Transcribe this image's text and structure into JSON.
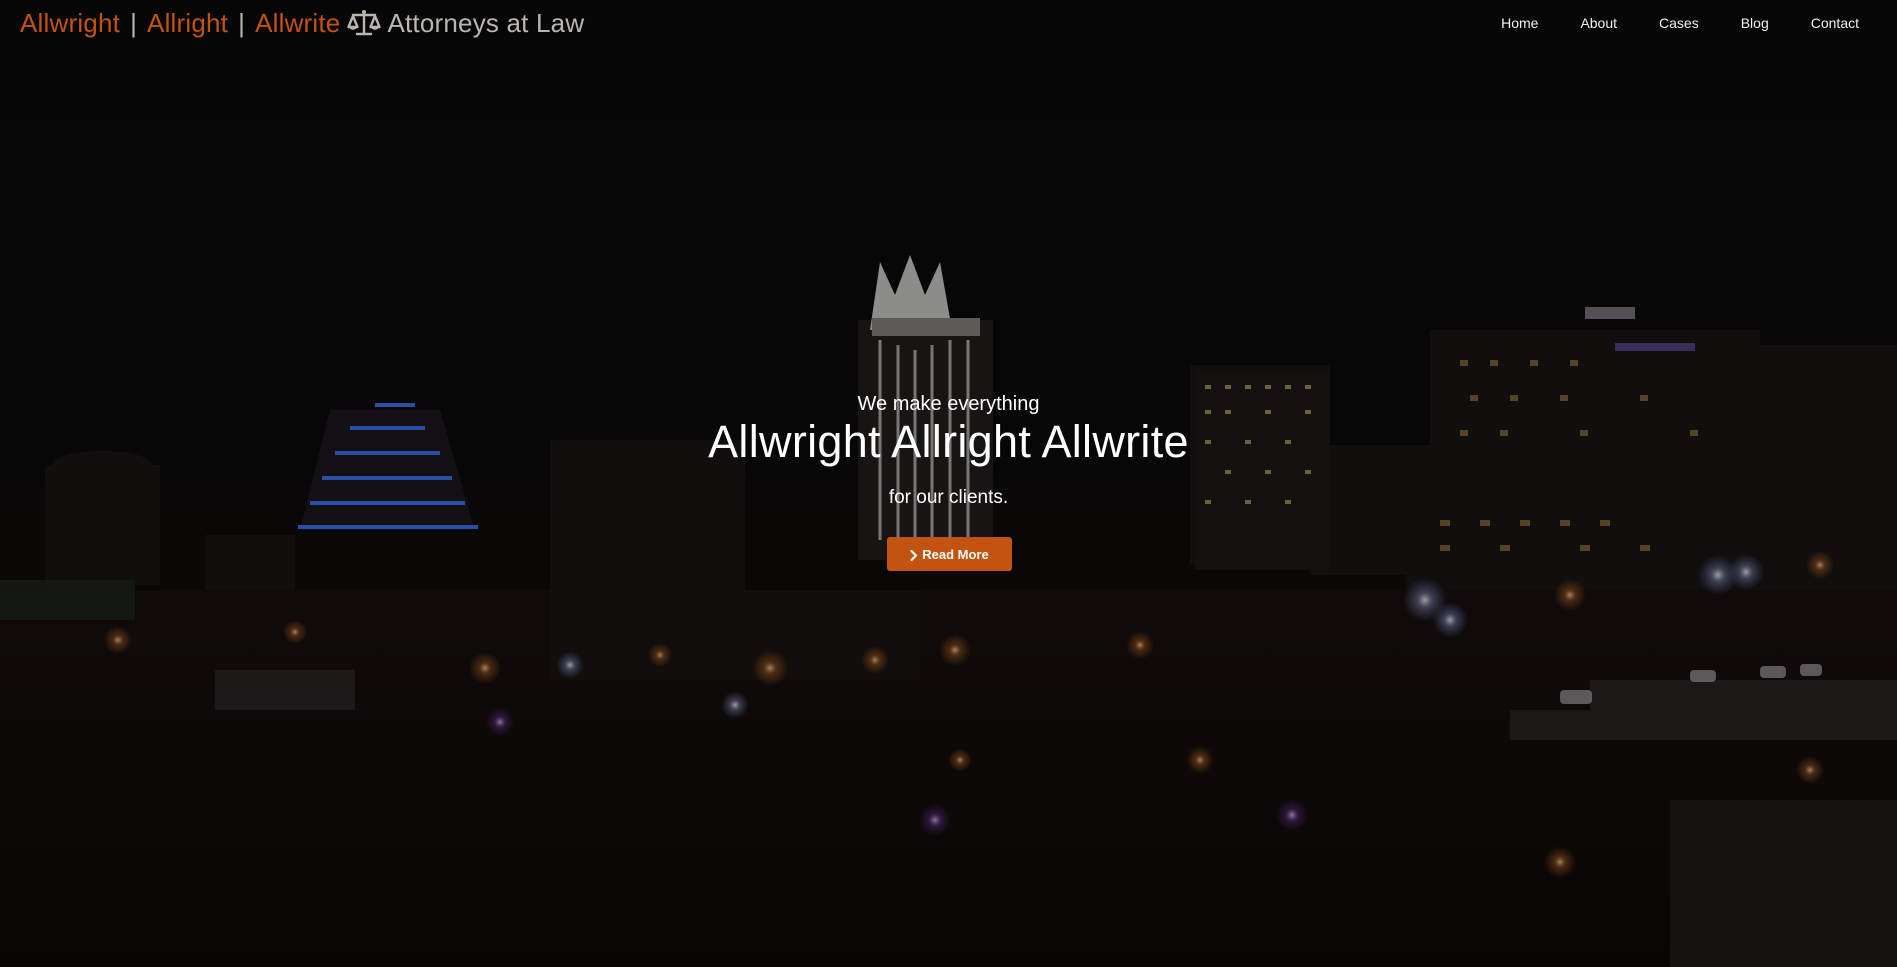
{
  "header": {
    "brand": {
      "name_1": "Allwright",
      "separator_1": "|",
      "name_2": "Allright",
      "separator_2": "|",
      "name_3": "Allwrite",
      "icon": "balance-scale-icon",
      "tagline": "Attorneys at Law"
    },
    "nav": [
      {
        "label": "Home"
      },
      {
        "label": "About"
      },
      {
        "label": "Cases"
      },
      {
        "label": "Blog"
      },
      {
        "label": "Contact"
      }
    ]
  },
  "hero": {
    "kicker": "We make everything",
    "title": "Allwright Allright Allwrite",
    "subtitle": "for our clients.",
    "button": {
      "icon": "chevron-right-icon",
      "label": "Read More"
    },
    "background": "night-city-skyline-photo"
  },
  "colors": {
    "accent": "#c35310",
    "brand_grey": "#b9b6b2",
    "text": "#ffffff",
    "background": "#0a0909"
  }
}
